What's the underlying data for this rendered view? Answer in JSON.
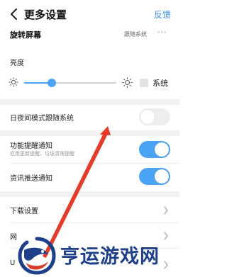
{
  "header": {
    "back_icon": "chevron-left-icon",
    "title": "更多设置",
    "feedback": "反馈"
  },
  "rotate": {
    "label": "旋转屏幕",
    "value": "跟随系统",
    "more": "···"
  },
  "brightness": {
    "label": "亮度",
    "level": 0.3,
    "system_label": "系统",
    "system_checked": false
  },
  "settings": {
    "day_night": {
      "label": "日夜间模式跟随系统",
      "on": false
    },
    "reminder": {
      "label": "功能提醒通知",
      "sub": "应用更新提醒，垃圾清理提醒",
      "on": true
    },
    "news": {
      "label": "资讯推送通知",
      "on": true
    },
    "download": {
      "label": "下载设置"
    },
    "partial_row_a": {
      "label": "网"
    },
    "partial_row_b": {
      "label": "U"
    }
  },
  "watermark": {
    "text": "亨运游戏网",
    "color": "#1e3f8a"
  },
  "colors": {
    "accent": "#4aa3f5",
    "annotation_arrow": "#e53b2a"
  }
}
